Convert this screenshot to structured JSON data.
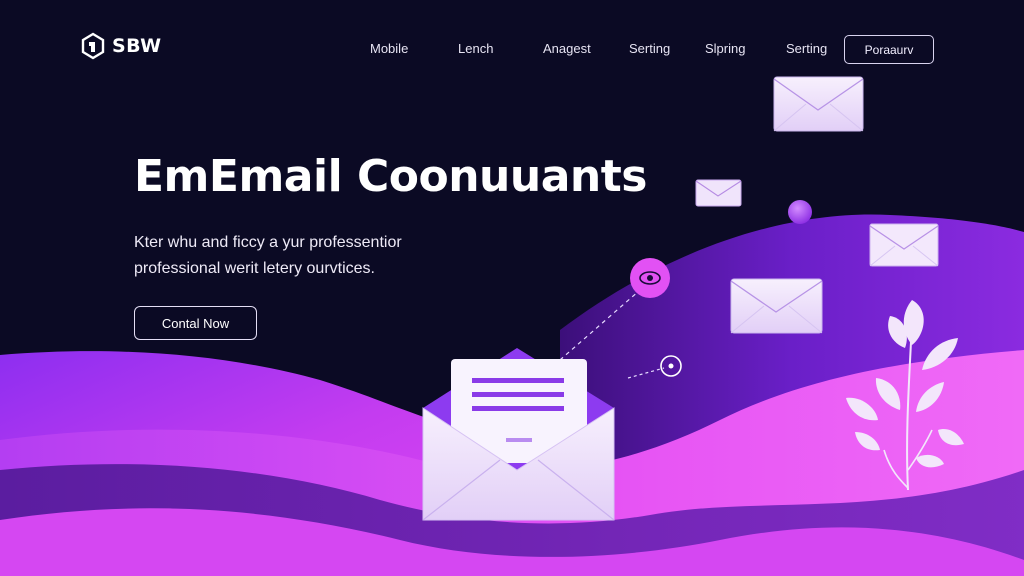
{
  "brand": {
    "name": "SBW"
  },
  "nav": {
    "items": [
      {
        "label": "Mobile"
      },
      {
        "label": "Lench"
      },
      {
        "label": "Anagest"
      },
      {
        "label": "Serting"
      },
      {
        "label": "Slpring"
      },
      {
        "label": "Serting"
      }
    ],
    "cta_label": "Poraaurv"
  },
  "hero": {
    "title": "EmEmail Coonuuants",
    "subtitle": "Kter whu and ficcy a yur professentior professional werit letery ourvtices.",
    "button_label": "Contal Now"
  },
  "colors": {
    "background": "#0b0a24",
    "accent_purple": "#8a2be2",
    "accent_magenta": "#e040fb",
    "envelope_light": "#f1e7fb"
  },
  "icons": [
    "logo-icon",
    "envelope-icon",
    "envelope-open-icon",
    "eye-icon",
    "plant-icon"
  ]
}
